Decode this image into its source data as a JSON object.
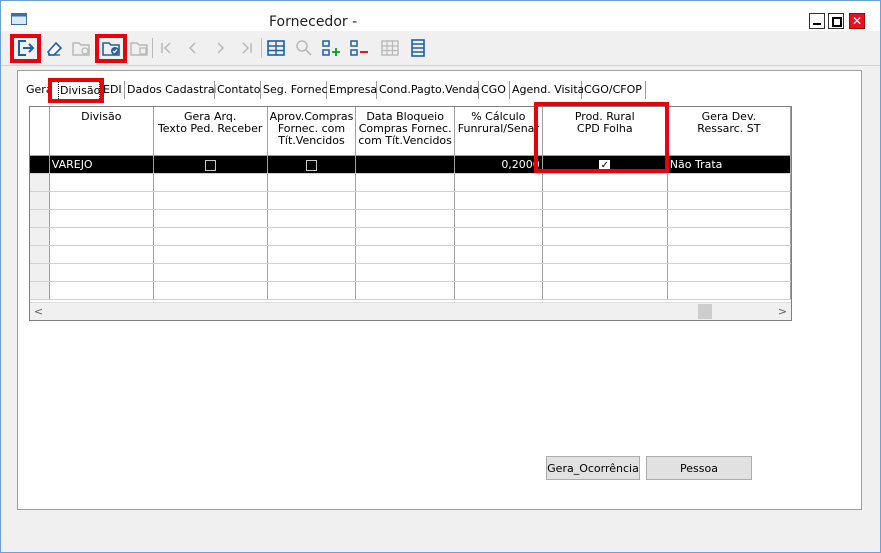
{
  "window": {
    "title": "Fornecedor -",
    "close_glyph": "✕"
  },
  "toolbar": [
    {
      "name": "exit-icon"
    },
    {
      "name": "eraser-icon"
    },
    {
      "name": "folder-disabled-icon"
    },
    {
      "name": "folder-check-icon"
    },
    {
      "name": "folder-disabled2-icon"
    },
    {
      "name": "first-icon"
    },
    {
      "name": "prev-icon"
    },
    {
      "name": "next-icon"
    },
    {
      "name": "last-icon"
    },
    {
      "name": "grid-icon"
    },
    {
      "name": "search-icon"
    },
    {
      "name": "add-row-icon"
    },
    {
      "name": "remove-row-icon"
    },
    {
      "name": "table-disabled-icon"
    },
    {
      "name": "columns-icon"
    }
  ],
  "tabs": [
    "Geral",
    "Divisão",
    "EDI",
    "Dados Cadastrais",
    "Contato",
    "Seg. Fornec",
    "Empresa",
    "Cond.Pagto.Vendas",
    "CGO",
    "Agend. Visita",
    "CGO/CFOP"
  ],
  "grid": {
    "columns": [
      {
        "l1": "Divisão",
        "l2": "",
        "l3": ""
      },
      {
        "l1": "Gera Arq.",
        "l2": "Texto Ped. Receber",
        "l3": ""
      },
      {
        "l1": "Aprov.Compras",
        "l2": "Fornec. com",
        "l3": "Tít.Vencidos"
      },
      {
        "l1": "Data Bloqueio",
        "l2": "Compras Fornec.",
        "l3": "com Tít.Vencidos"
      },
      {
        "l1": "% Cálculo",
        "l2": "Funrural/Senar",
        "l3": ""
      },
      {
        "l1": "Prod. Rural",
        "l2": "CPD Folha",
        "l3": ""
      },
      {
        "l1": "Gera Dev.",
        "l2": "Ressarc. ST",
        "l3": ""
      }
    ],
    "row": {
      "divisao": "VAREJO",
      "percent": "0,2000",
      "gera_dev": "Não Trata",
      "checkmark": "✓"
    },
    "scroll_left": "<",
    "scroll_right": ">"
  },
  "buttons": {
    "gera_ocorrencia": "Gera_Ocorrência",
    "pessoa": "Pessoa"
  },
  "colors": {
    "highlight": "#e8000b",
    "selected_row": "#000000"
  }
}
